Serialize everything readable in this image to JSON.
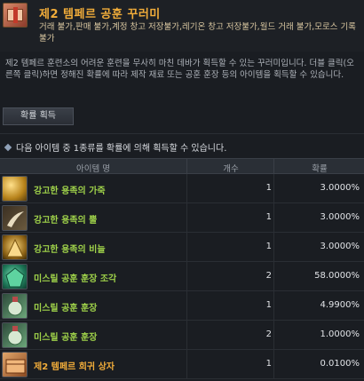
{
  "header": {
    "title": "제2 템페르 공훈 꾸러미",
    "restrictions": "거래 불가,판매 불가,계정 창고 저장불가,레기온 창고 저장불가,월드 거래 불가,모로스 기록 불가"
  },
  "description": "제2 템페르 훈련소의 어려운 훈련을 무사히 마친 데바가 획득할 수 있는 꾸러미입니다. 더블 클릭(오른쪽 클릭)하면 정해진 확률에 따라 제작 재료 또는 공훈 훈장 등의 아이템을 획득할 수 있습니다.",
  "acquire_button": "확률 획득",
  "section_heading": "다음 아이템 중 1종류를 확률에 의해 획득할 수 있습니다.",
  "table": {
    "columns": [
      "아이템 명",
      "개수",
      "확률"
    ],
    "rows": [
      {
        "name": "강고한 용족의 가죽",
        "qty": "1",
        "rate": "3.0000%",
        "color": "#9fd24a",
        "icon": "gold-leather-icon"
      },
      {
        "name": "강고한 용족의 뿔",
        "qty": "1",
        "rate": "3.0000%",
        "color": "#9fd24a",
        "icon": "horn-icon"
      },
      {
        "name": "강고한 용족의 비늘",
        "qty": "1",
        "rate": "3.0000%",
        "color": "#9fd24a",
        "icon": "scale-icon"
      },
      {
        "name": "미스릴 공훈 훈장 조각",
        "qty": "2",
        "rate": "58.0000%",
        "color": "#9fd24a",
        "icon": "medal-fragment-icon"
      },
      {
        "name": "미스릴 공훈 훈장",
        "qty": "1",
        "rate": "4.9900%",
        "color": "#9fd24a",
        "icon": "medal-icon"
      },
      {
        "name": "미스릴 공훈 훈장",
        "qty": "2",
        "rate": "1.0000%",
        "color": "#9fd24a",
        "icon": "medal-icon"
      },
      {
        "name": "제2 템페르 희귀 상자",
        "qty": "1",
        "rate": "0.0100%",
        "color": "#f2ad3a",
        "icon": "box-icon"
      }
    ]
  }
}
